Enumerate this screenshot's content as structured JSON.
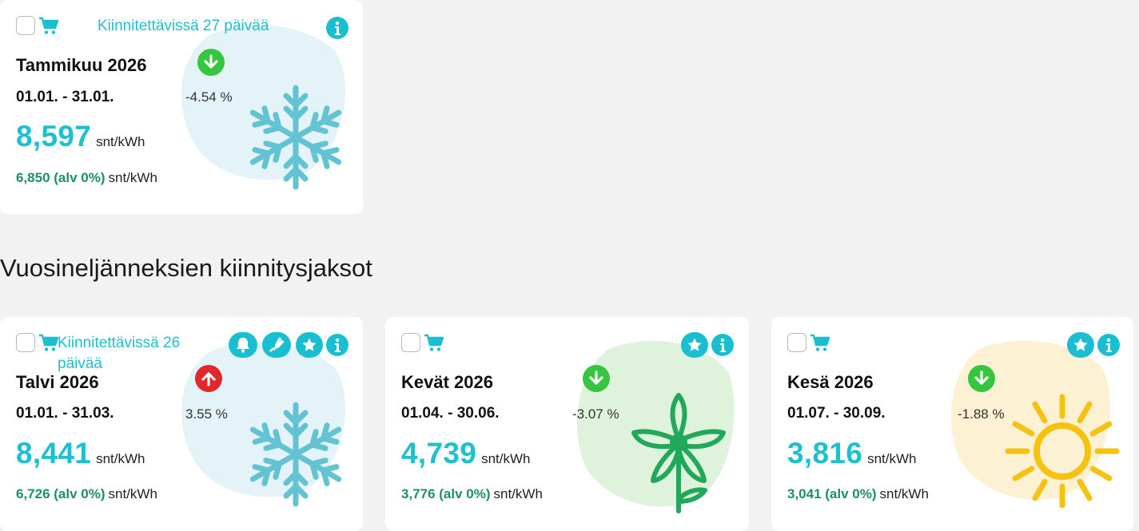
{
  "monthly_card": {
    "availability": "Kiinnitettävissä 27 päivää",
    "title": "Tammikuu 2026",
    "dates": "01.01. - 31.01.",
    "change": "-4.54 %",
    "trend": "down",
    "price": "8,597",
    "price_unit": "snt/kWh",
    "vat_price": "6,850 (alv 0%)",
    "vat_unit": "snt/kWh",
    "season_icon": "snowflake-icon"
  },
  "section_title": "Vuosineljänneksien kiinnitysjaksot",
  "quarter_cards": [
    {
      "availability": "Kiinnitettävissä 26 päivää",
      "title": "Talvi 2026",
      "dates": "01.01. - 31.03.",
      "change": "3.55 %",
      "trend": "up",
      "price": "8,441",
      "price_unit": "snt/kWh",
      "vat_price": "6,726 (alv 0%)",
      "vat_unit": "snt/kWh",
      "season_icon": "snowflake-icon",
      "badges": [
        "bell-icon",
        "plug-icon",
        "star-icon",
        "info-icon"
      ]
    },
    {
      "title": "Kevät 2026",
      "dates": "01.04. - 30.06.",
      "change": "-3.07 %",
      "trend": "down",
      "price": "4,739",
      "price_unit": "snt/kWh",
      "vat_price": "3,776 (alv 0%)",
      "vat_unit": "snt/kWh",
      "season_icon": "flower-icon",
      "badges": [
        "star-icon",
        "info-icon"
      ]
    },
    {
      "title": "Kesä 2026",
      "dates": "01.07. - 30.09.",
      "change": "-1.88 %",
      "trend": "down",
      "price": "3,816",
      "price_unit": "snt/kWh",
      "vat_price": "3,041 (alv 0%)",
      "vat_unit": "snt/kWh",
      "season_icon": "sun-icon",
      "badges": [
        "star-icon",
        "info-icon"
      ]
    }
  ],
  "colors": {
    "accent": "#1ec0cf",
    "vat_green": "#1a8f6a",
    "trend_down": "#35c53f",
    "trend_up": "#e2262a",
    "winter_blob": "#e4f3f8",
    "spring_blob": "#dff3dc",
    "summer_blob": "#fdf1d4"
  }
}
